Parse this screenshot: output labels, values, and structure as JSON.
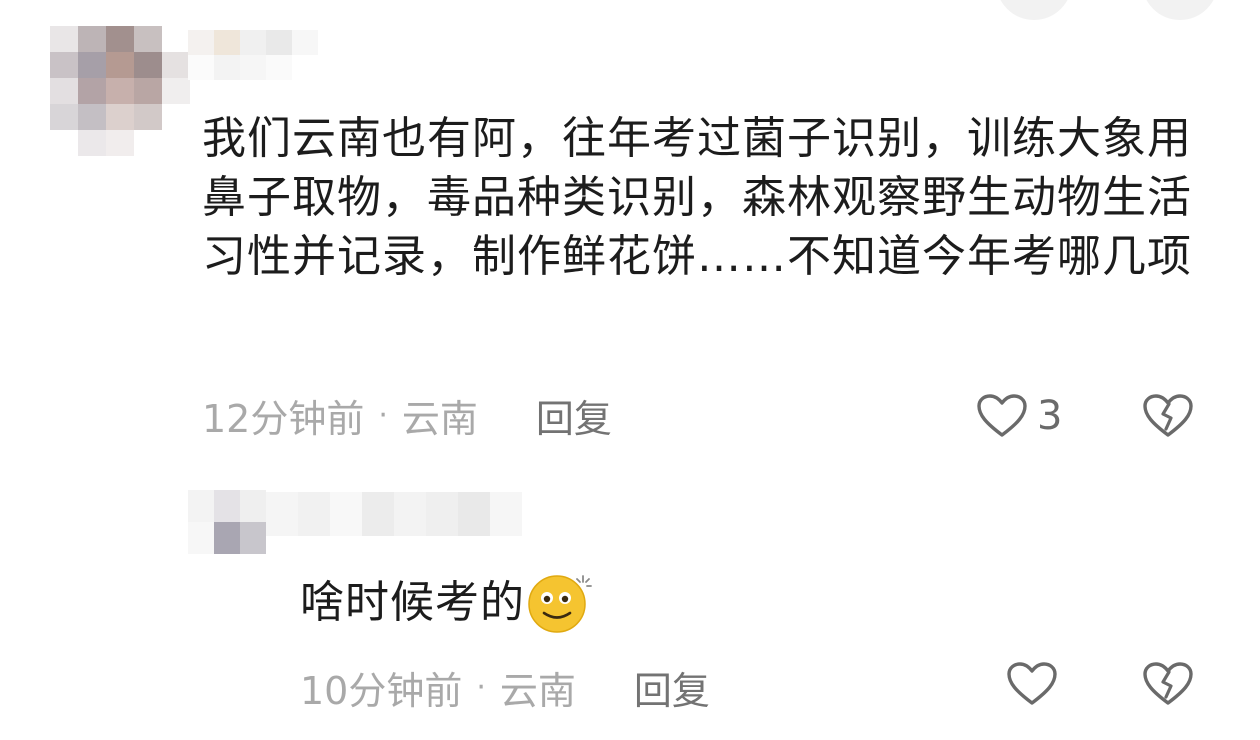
{
  "comments": [
    {
      "text": "我们云南也有阿，往年考过菌子识别，训练大象用鼻子取物，毒品种类识别，森林观察野生动物生活习性并记录，制作鲜花饼……不知道今年考哪几项",
      "time": "12分钟前",
      "location": "云南",
      "reply_label": "回复",
      "like_count": "3"
    },
    {
      "text": "啥时候考的",
      "emoji": "dizzy-face-emoji",
      "time": "10分钟前",
      "location": "云南",
      "reply_label": "回复",
      "like_count": ""
    }
  ],
  "meta": {
    "separator": "·"
  },
  "icons": {
    "like": "heart-outline-icon",
    "dislike": "broken-heart-icon"
  },
  "colors": {
    "text": "#1c1c1c",
    "meta": "#a9a9a9",
    "reply": "#737373",
    "icon": "#6a6a6a",
    "emoji": "#f5c430"
  }
}
